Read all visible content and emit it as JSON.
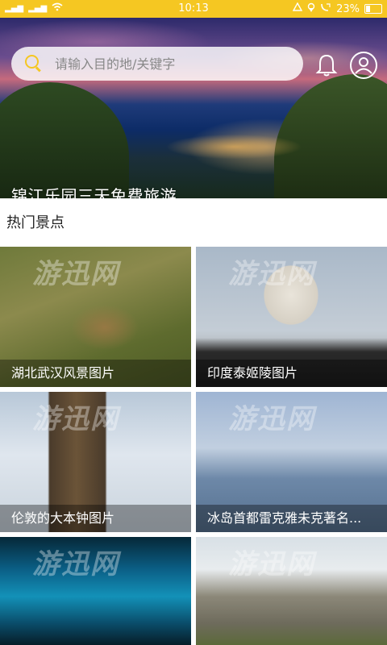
{
  "status_bar": {
    "left_icons": [
      "signal-icon",
      "signal-icon",
      "wifi-icon"
    ],
    "time": "10:13",
    "right_icons": [
      "alarm-icon",
      "location-icon",
      "volte-icon"
    ],
    "battery": "23%"
  },
  "search": {
    "placeholder": "请输入目的地/关键字"
  },
  "hero": {
    "caption": "锦江乐园三天免费旅游"
  },
  "section": {
    "title": "热门景点"
  },
  "attractions": [
    {
      "label": "湖北武汉风景图片"
    },
    {
      "label": "印度泰姬陵图片"
    },
    {
      "label": "伦敦的大本钟图片"
    },
    {
      "label": "冰岛首都雷克雅未克著名..."
    },
    {
      "label": ""
    },
    {
      "label": ""
    }
  ],
  "watermark": "游迅网",
  "colors": {
    "accent": "#f5c722"
  }
}
